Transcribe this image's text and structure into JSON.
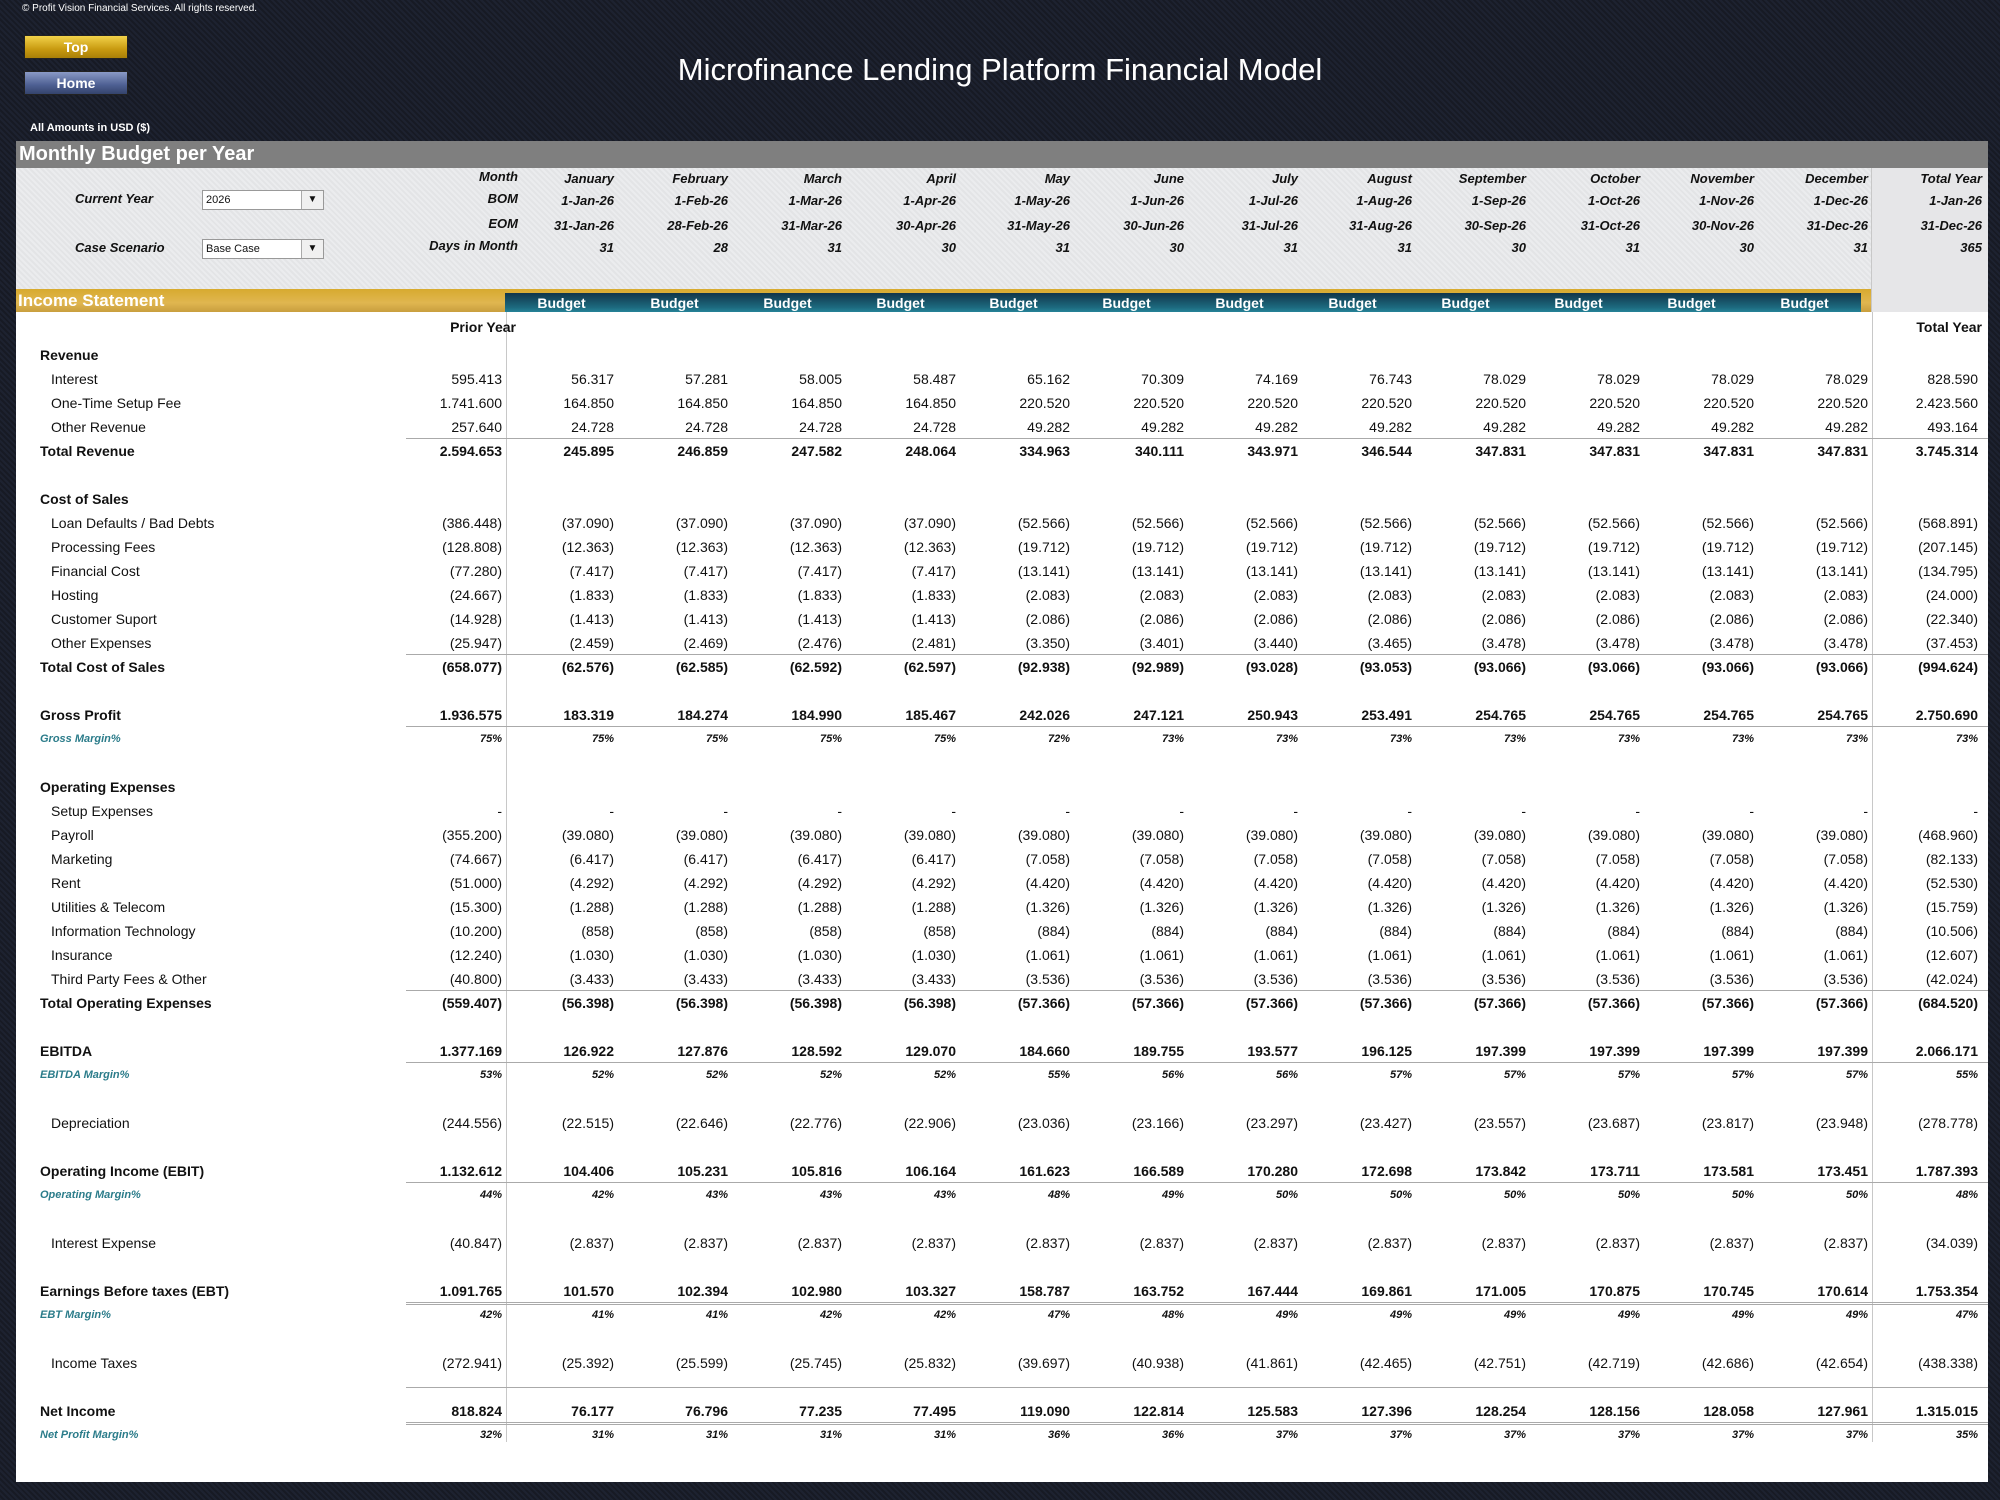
{
  "copyright": "© Profit Vision Financial Services. All rights reserved.",
  "nav": {
    "top_label": "Top",
    "home_label": "Home"
  },
  "title": "Microfinance Lending Platform Financial Model",
  "amounts_note": "All Amounts in  USD ($)",
  "section_title": "Monthly Budget per Year",
  "controls": {
    "current_year_label": "Current Year",
    "current_year_value": "2026",
    "case_scenario_label": "Case Scenario",
    "case_scenario_value": "Base Case"
  },
  "header_labels": {
    "month": "Month",
    "bom": "BOM",
    "eom": "EOM",
    "days": "Days in Month"
  },
  "months": [
    {
      "name": "January",
      "bom": "1-Jan-26",
      "eom": "31-Jan-26",
      "days": "31",
      "type": "Budget"
    },
    {
      "name": "February",
      "bom": "1-Feb-26",
      "eom": "28-Feb-26",
      "days": "28",
      "type": "Budget"
    },
    {
      "name": "March",
      "bom": "1-Mar-26",
      "eom": "31-Mar-26",
      "days": "31",
      "type": "Budget"
    },
    {
      "name": "April",
      "bom": "1-Apr-26",
      "eom": "30-Apr-26",
      "days": "30",
      "type": "Budget"
    },
    {
      "name": "May",
      "bom": "1-May-26",
      "eom": "31-May-26",
      "days": "31",
      "type": "Budget"
    },
    {
      "name": "June",
      "bom": "1-Jun-26",
      "eom": "30-Jun-26",
      "days": "30",
      "type": "Budget"
    },
    {
      "name": "July",
      "bom": "1-Jul-26",
      "eom": "31-Jul-26",
      "days": "31",
      "type": "Budget"
    },
    {
      "name": "August",
      "bom": "1-Aug-26",
      "eom": "31-Aug-26",
      "days": "31",
      "type": "Budget"
    },
    {
      "name": "September",
      "bom": "1-Sep-26",
      "eom": "30-Sep-26",
      "days": "30",
      "type": "Budget"
    },
    {
      "name": "October",
      "bom": "1-Oct-26",
      "eom": "31-Oct-26",
      "days": "31",
      "type": "Budget"
    },
    {
      "name": "November",
      "bom": "1-Nov-26",
      "eom": "30-Nov-26",
      "days": "30",
      "type": "Budget"
    },
    {
      "name": "December",
      "bom": "1-Dec-26",
      "eom": "31-Dec-26",
      "days": "31",
      "type": "Budget"
    }
  ],
  "total_year": {
    "name": "Total Year",
    "bom": "1-Jan-26",
    "eom": "31-Dec-26",
    "days": "365"
  },
  "income_statement_title": "Income Statement",
  "col_headers": {
    "prior_year": "Prior Year",
    "total_year": "Total Year"
  },
  "rows": [
    {
      "label": "Revenue",
      "style": "heading",
      "values": []
    },
    {
      "label": "Interest",
      "style": "item",
      "prior": "595.413",
      "values": [
        "56.317",
        "57.281",
        "58.005",
        "58.487",
        "65.162",
        "70.309",
        "74.169",
        "76.743",
        "78.029",
        "78.029",
        "78.029",
        "78.029"
      ],
      "total": "828.590"
    },
    {
      "label": "One-Time Setup Fee",
      "style": "item",
      "prior": "1.741.600",
      "values": [
        "164.850",
        "164.850",
        "164.850",
        "164.850",
        "220.520",
        "220.520",
        "220.520",
        "220.520",
        "220.520",
        "220.520",
        "220.520",
        "220.520"
      ],
      "total": "2.423.560"
    },
    {
      "label": "Other Revenue",
      "style": "item",
      "prior": "257.640",
      "values": [
        "24.728",
        "24.728",
        "24.728",
        "24.728",
        "49.282",
        "49.282",
        "49.282",
        "49.282",
        "49.282",
        "49.282",
        "49.282",
        "49.282"
      ],
      "total": "493.164"
    },
    {
      "label": "Total Revenue",
      "style": "total",
      "prior": "2.594.653",
      "values": [
        "245.895",
        "246.859",
        "247.582",
        "248.064",
        "334.963",
        "340.111",
        "343.971",
        "346.544",
        "347.831",
        "347.831",
        "347.831",
        "347.831"
      ],
      "total": "3.745.314"
    },
    {
      "label": "",
      "style": "blank"
    },
    {
      "label": "Cost of Sales",
      "style": "heading",
      "values": []
    },
    {
      "label": "Loan Defaults / Bad Debts",
      "style": "item",
      "prior": "(386.448)",
      "values": [
        "(37.090)",
        "(37.090)",
        "(37.090)",
        "(37.090)",
        "(52.566)",
        "(52.566)",
        "(52.566)",
        "(52.566)",
        "(52.566)",
        "(52.566)",
        "(52.566)",
        "(52.566)"
      ],
      "total": "(568.891)"
    },
    {
      "label": "Processing Fees",
      "style": "item",
      "prior": "(128.808)",
      "values": [
        "(12.363)",
        "(12.363)",
        "(12.363)",
        "(12.363)",
        "(19.712)",
        "(19.712)",
        "(19.712)",
        "(19.712)",
        "(19.712)",
        "(19.712)",
        "(19.712)",
        "(19.712)"
      ],
      "total": "(207.145)"
    },
    {
      "label": "Financial Cost",
      "style": "item",
      "prior": "(77.280)",
      "values": [
        "(7.417)",
        "(7.417)",
        "(7.417)",
        "(7.417)",
        "(13.141)",
        "(13.141)",
        "(13.141)",
        "(13.141)",
        "(13.141)",
        "(13.141)",
        "(13.141)",
        "(13.141)"
      ],
      "total": "(134.795)"
    },
    {
      "label": "Hosting",
      "style": "item",
      "prior": "(24.667)",
      "values": [
        "(1.833)",
        "(1.833)",
        "(1.833)",
        "(1.833)",
        "(2.083)",
        "(2.083)",
        "(2.083)",
        "(2.083)",
        "(2.083)",
        "(2.083)",
        "(2.083)",
        "(2.083)"
      ],
      "total": "(24.000)"
    },
    {
      "label": "Customer Suport",
      "style": "item",
      "prior": "(14.928)",
      "values": [
        "(1.413)",
        "(1.413)",
        "(1.413)",
        "(1.413)",
        "(2.086)",
        "(2.086)",
        "(2.086)",
        "(2.086)",
        "(2.086)",
        "(2.086)",
        "(2.086)",
        "(2.086)"
      ],
      "total": "(22.340)"
    },
    {
      "label": "Other Expenses",
      "style": "item",
      "prior": "(25.947)",
      "values": [
        "(2.459)",
        "(2.469)",
        "(2.476)",
        "(2.481)",
        "(3.350)",
        "(3.401)",
        "(3.440)",
        "(3.465)",
        "(3.478)",
        "(3.478)",
        "(3.478)",
        "(3.478)"
      ],
      "total": "(37.453)"
    },
    {
      "label": "Total Cost of Sales",
      "style": "total",
      "prior": "(658.077)",
      "values": [
        "(62.576)",
        "(62.585)",
        "(62.592)",
        "(62.597)",
        "(92.938)",
        "(92.989)",
        "(93.028)",
        "(93.053)",
        "(93.066)",
        "(93.066)",
        "(93.066)",
        "(93.066)"
      ],
      "total": "(994.624)"
    },
    {
      "label": "",
      "style": "blank"
    },
    {
      "label": "Gross Profit",
      "style": "total",
      "prior": "1.936.575",
      "values": [
        "183.319",
        "184.274",
        "184.990",
        "185.467",
        "242.026",
        "247.121",
        "250.943",
        "253.491",
        "254.765",
        "254.765",
        "254.765",
        "254.765"
      ],
      "total": "2.750.690",
      "underline": true
    },
    {
      "label": "Gross Margin%",
      "style": "margin",
      "prior": "75%",
      "values": [
        "75%",
        "75%",
        "75%",
        "75%",
        "72%",
        "73%",
        "73%",
        "73%",
        "73%",
        "73%",
        "73%",
        "73%"
      ],
      "total": "73%"
    },
    {
      "label": "",
      "style": "blank"
    },
    {
      "label": "Operating Expenses",
      "style": "heading",
      "values": []
    },
    {
      "label": "Setup Expenses",
      "style": "item",
      "prior": "-",
      "values": [
        "-",
        "-",
        "-",
        "-",
        "-",
        "-",
        "-",
        "-",
        "-",
        "-",
        "-",
        "-"
      ],
      "total": "-"
    },
    {
      "label": "Payroll",
      "style": "item",
      "prior": "(355.200)",
      "values": [
        "(39.080)",
        "(39.080)",
        "(39.080)",
        "(39.080)",
        "(39.080)",
        "(39.080)",
        "(39.080)",
        "(39.080)",
        "(39.080)",
        "(39.080)",
        "(39.080)",
        "(39.080)"
      ],
      "total": "(468.960)"
    },
    {
      "label": "Marketing",
      "style": "item",
      "prior": "(74.667)",
      "values": [
        "(6.417)",
        "(6.417)",
        "(6.417)",
        "(6.417)",
        "(7.058)",
        "(7.058)",
        "(7.058)",
        "(7.058)",
        "(7.058)",
        "(7.058)",
        "(7.058)",
        "(7.058)"
      ],
      "total": "(82.133)"
    },
    {
      "label": "Rent",
      "style": "item",
      "prior": "(51.000)",
      "values": [
        "(4.292)",
        "(4.292)",
        "(4.292)",
        "(4.292)",
        "(4.420)",
        "(4.420)",
        "(4.420)",
        "(4.420)",
        "(4.420)",
        "(4.420)",
        "(4.420)",
        "(4.420)"
      ],
      "total": "(52.530)"
    },
    {
      "label": "Utilities & Telecom",
      "style": "item",
      "prior": "(15.300)",
      "values": [
        "(1.288)",
        "(1.288)",
        "(1.288)",
        "(1.288)",
        "(1.326)",
        "(1.326)",
        "(1.326)",
        "(1.326)",
        "(1.326)",
        "(1.326)",
        "(1.326)",
        "(1.326)"
      ],
      "total": "(15.759)"
    },
    {
      "label": "Information Technology",
      "style": "item",
      "prior": "(10.200)",
      "values": [
        "(858)",
        "(858)",
        "(858)",
        "(858)",
        "(884)",
        "(884)",
        "(884)",
        "(884)",
        "(884)",
        "(884)",
        "(884)",
        "(884)"
      ],
      "total": "(10.506)"
    },
    {
      "label": "Insurance",
      "style": "item",
      "prior": "(12.240)",
      "values": [
        "(1.030)",
        "(1.030)",
        "(1.030)",
        "(1.030)",
        "(1.061)",
        "(1.061)",
        "(1.061)",
        "(1.061)",
        "(1.061)",
        "(1.061)",
        "(1.061)",
        "(1.061)"
      ],
      "total": "(12.607)"
    },
    {
      "label": "Third Party Fees & Other",
      "style": "item",
      "prior": "(40.800)",
      "values": [
        "(3.433)",
        "(3.433)",
        "(3.433)",
        "(3.433)",
        "(3.536)",
        "(3.536)",
        "(3.536)",
        "(3.536)",
        "(3.536)",
        "(3.536)",
        "(3.536)",
        "(3.536)"
      ],
      "total": "(42.024)"
    },
    {
      "label": "Total Operating Expenses",
      "style": "total",
      "prior": "(559.407)",
      "values": [
        "(56.398)",
        "(56.398)",
        "(56.398)",
        "(56.398)",
        "(57.366)",
        "(57.366)",
        "(57.366)",
        "(57.366)",
        "(57.366)",
        "(57.366)",
        "(57.366)",
        "(57.366)"
      ],
      "total": "(684.520)"
    },
    {
      "label": "",
      "style": "blank"
    },
    {
      "label": "EBITDA",
      "style": "total",
      "prior": "1.377.169",
      "values": [
        "126.922",
        "127.876",
        "128.592",
        "129.070",
        "184.660",
        "189.755",
        "193.577",
        "196.125",
        "197.399",
        "197.399",
        "197.399",
        "197.399"
      ],
      "total": "2.066.171",
      "underline": true
    },
    {
      "label": "EBITDA Margin%",
      "style": "margin",
      "prior": "53%",
      "values": [
        "52%",
        "52%",
        "52%",
        "52%",
        "55%",
        "56%",
        "56%",
        "57%",
        "57%",
        "57%",
        "57%",
        "57%"
      ],
      "total": "55%"
    },
    {
      "label": "",
      "style": "blank"
    },
    {
      "label": "Depreciation",
      "style": "item",
      "prior": "(244.556)",
      "values": [
        "(22.515)",
        "(22.646)",
        "(22.776)",
        "(22.906)",
        "(23.036)",
        "(23.166)",
        "(23.297)",
        "(23.427)",
        "(23.557)",
        "(23.687)",
        "(23.817)",
        "(23.948)"
      ],
      "total": "(278.778)"
    },
    {
      "label": "",
      "style": "blank"
    },
    {
      "label": "Operating Income (EBIT)",
      "style": "total",
      "prior": "1.132.612",
      "values": [
        "104.406",
        "105.231",
        "105.816",
        "106.164",
        "161.623",
        "166.589",
        "170.280",
        "172.698",
        "173.842",
        "173.711",
        "173.581",
        "173.451"
      ],
      "total": "1.787.393",
      "underline": true
    },
    {
      "label": "Operating Margin%",
      "style": "margin",
      "prior": "44%",
      "values": [
        "42%",
        "43%",
        "43%",
        "43%",
        "48%",
        "49%",
        "50%",
        "50%",
        "50%",
        "50%",
        "50%",
        "50%"
      ],
      "total": "48%"
    },
    {
      "label": "",
      "style": "blank"
    },
    {
      "label": "Interest Expense",
      "style": "item",
      "prior": "(40.847)",
      "values": [
        "(2.837)",
        "(2.837)",
        "(2.837)",
        "(2.837)",
        "(2.837)",
        "(2.837)",
        "(2.837)",
        "(2.837)",
        "(2.837)",
        "(2.837)",
        "(2.837)",
        "(2.837)"
      ],
      "total": "(34.039)"
    },
    {
      "label": "",
      "style": "blank"
    },
    {
      "label": "Earnings Before taxes (EBT)",
      "style": "total",
      "prior": "1.091.765",
      "values": [
        "101.570",
        "102.394",
        "102.980",
        "103.327",
        "158.787",
        "163.752",
        "167.444",
        "169.861",
        "171.005",
        "170.875",
        "170.745",
        "170.614"
      ],
      "total": "1.753.354",
      "underline": "double"
    },
    {
      "label": "EBT Margin%",
      "style": "margin",
      "prior": "42%",
      "values": [
        "41%",
        "41%",
        "42%",
        "42%",
        "47%",
        "48%",
        "49%",
        "49%",
        "49%",
        "49%",
        "49%",
        "49%"
      ],
      "total": "47%"
    },
    {
      "label": "",
      "style": "blank"
    },
    {
      "label": "Income Taxes",
      "style": "item",
      "prior": "(272.941)",
      "values": [
        "(25.392)",
        "(25.599)",
        "(25.745)",
        "(25.832)",
        "(39.697)",
        "(40.938)",
        "(41.861)",
        "(42.465)",
        "(42.751)",
        "(42.719)",
        "(42.686)",
        "(42.654)"
      ],
      "total": "(438.338)"
    },
    {
      "label": "",
      "style": "blank"
    },
    {
      "label": "Net Income",
      "style": "total",
      "prior": "818.824",
      "values": [
        "76.177",
        "76.796",
        "77.235",
        "77.495",
        "119.090",
        "122.814",
        "125.583",
        "127.396",
        "128.254",
        "128.156",
        "128.058",
        "127.961"
      ],
      "total": "1.315.015",
      "overline": true,
      "underline": "double"
    },
    {
      "label": "Net Profit Margin%",
      "style": "margin",
      "prior": "32%",
      "values": [
        "31%",
        "31%",
        "31%",
        "31%",
        "36%",
        "36%",
        "37%",
        "37%",
        "37%",
        "37%",
        "37%",
        "37%"
      ],
      "total": "35%"
    }
  ]
}
